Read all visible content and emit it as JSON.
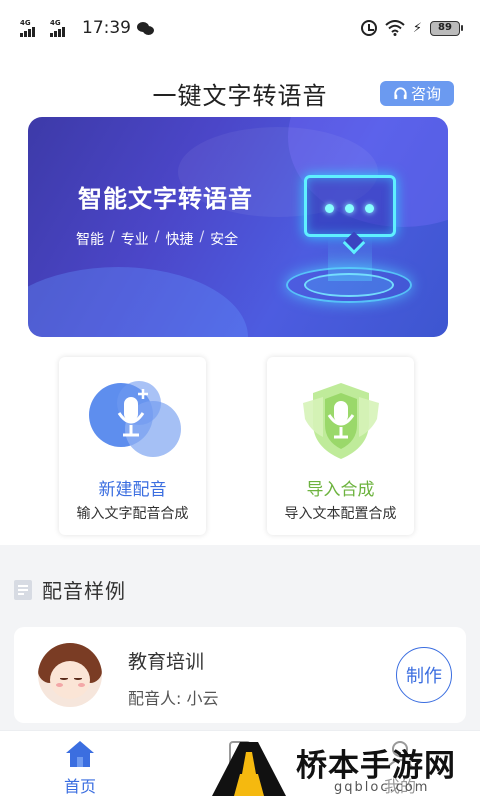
{
  "status_bar": {
    "signal1": "4G",
    "signal2": "4G",
    "time": "17:39",
    "battery": "89"
  },
  "header": {
    "title": "一键文字转语音",
    "consult_label": "咨询"
  },
  "banner": {
    "title": "智能文字转语音",
    "tags": [
      "智能",
      "专业",
      "快捷",
      "安全"
    ],
    "separator": "/"
  },
  "actions": [
    {
      "label": "新建配音",
      "desc": "输入文字配音合成",
      "icon": "microphone-plus-icon"
    },
    {
      "label": "导入合成",
      "desc": "导入文本配置合成",
      "icon": "shield-microphone-icon"
    }
  ],
  "samples_section": {
    "title": "配音样例",
    "items": [
      {
        "title": "教育培训",
        "voice_label": "配音人: 小云",
        "action": "制作"
      }
    ]
  },
  "bottom_nav": {
    "items": [
      {
        "label": "首页",
        "icon": "home-icon",
        "active": true
      },
      {
        "label": "",
        "icon": "document-icon",
        "active": false
      },
      {
        "label": "我的",
        "icon": "person-icon",
        "active": false
      }
    ]
  },
  "watermark": {
    "text": "桥本手游网",
    "url": "gqbloc.com"
  },
  "colors": {
    "primary": "#3b6ee0",
    "import_green": "#6db33f",
    "consult_bg": "#6b9af0",
    "banner_start": "#3d3aa8",
    "banner_end": "#3d56d0"
  }
}
